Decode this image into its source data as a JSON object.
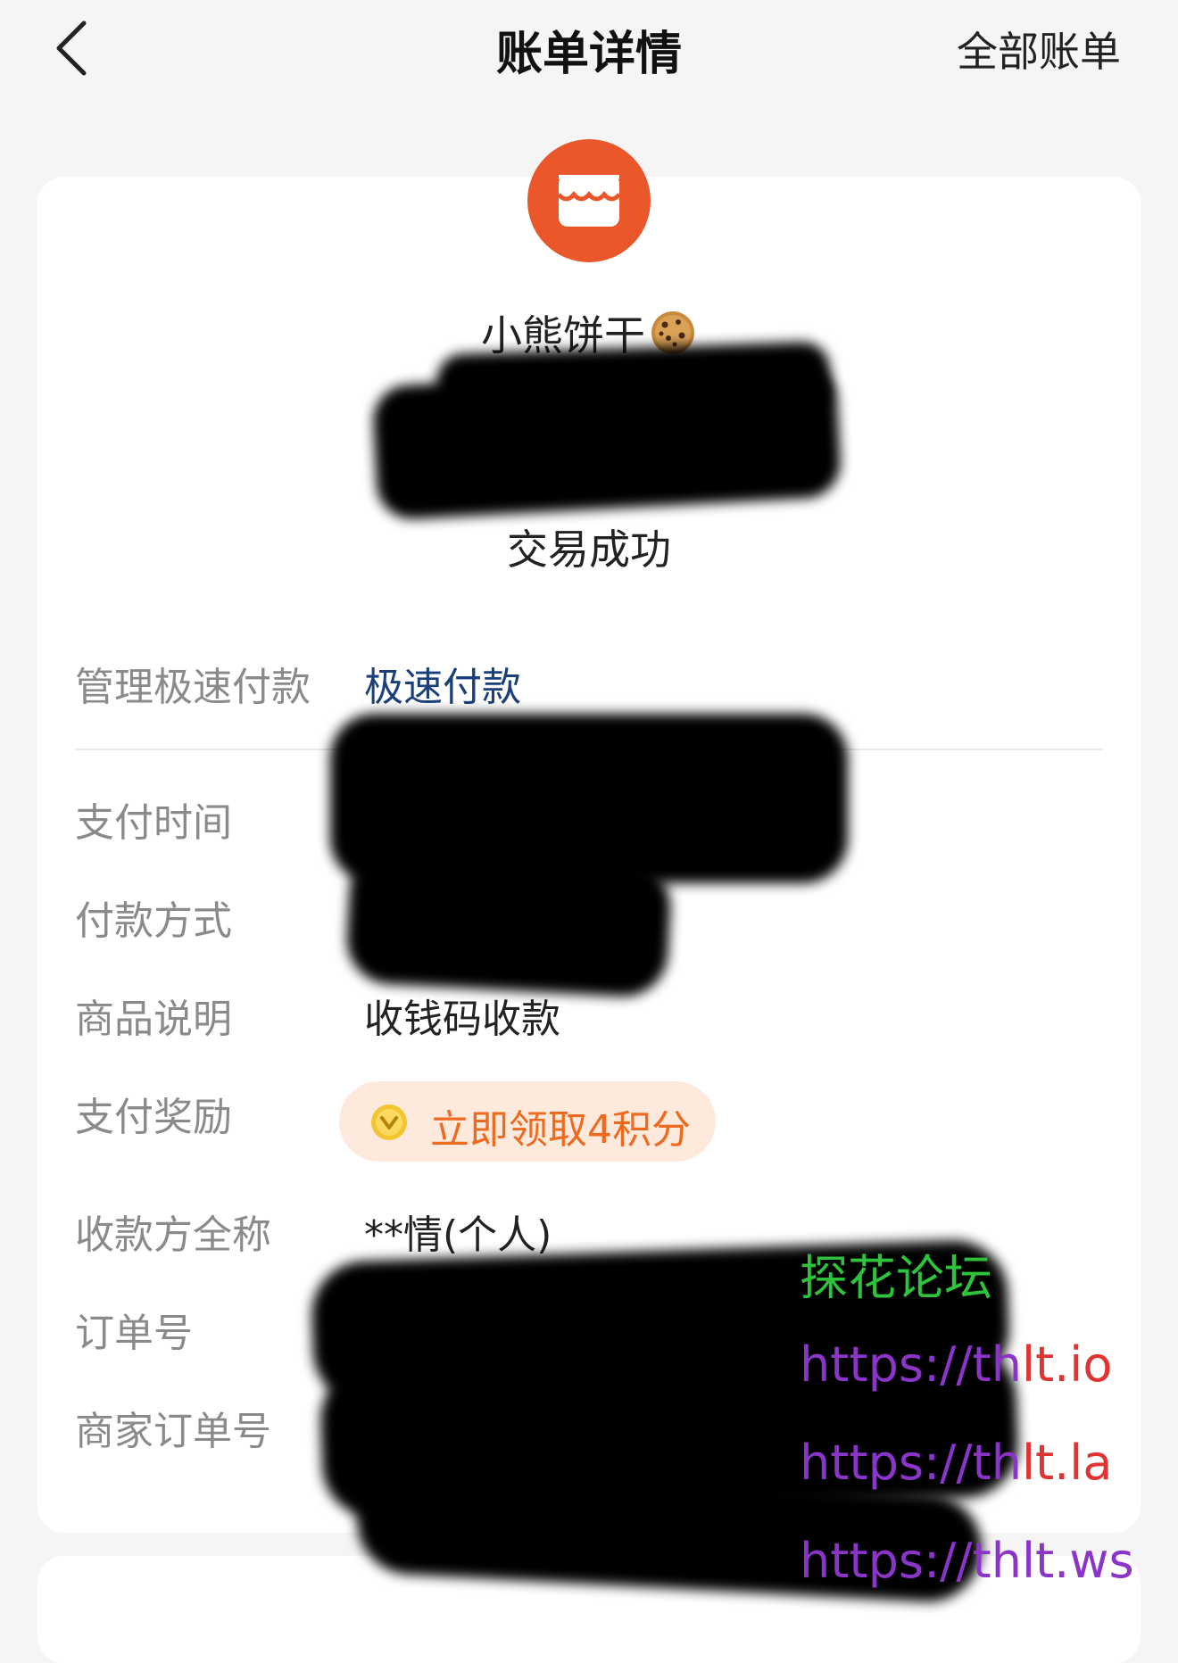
{
  "header": {
    "title": "账单详情",
    "all_bills_label": "全部账单"
  },
  "merchant": {
    "name": "小熊饼干",
    "icon": "store-icon",
    "emoji_icon": "cookie-icon"
  },
  "status": "交易成功",
  "manage_fast_pay": {
    "label": "管理极速付款",
    "value": "极速付款"
  },
  "details": {
    "pay_time_label": "支付时间",
    "pay_method_label": "付款方式",
    "product_desc_label": "商品说明",
    "product_desc_value": "收钱码收款",
    "reward_label": "支付奖励",
    "reward_button": "立即领取4积分",
    "payee_label": "收款方全称",
    "payee_value": "**情(个人)",
    "order_no_label": "订单号",
    "merchant_order_no_label": "商家订单号"
  },
  "watermark": {
    "forum_name": "探花论坛",
    "link1_prefix": "https://th",
    "link1_suffix": "lt.io",
    "link2_prefix": "https://th",
    "link2_suffix": "lt.la",
    "link3": "https://thlt.ws"
  },
  "colors": {
    "store_icon_bg": "#e9572a",
    "link_blue": "#1a3f7a",
    "reward_bg": "#fdeadd",
    "reward_text": "#ee6a1f"
  }
}
